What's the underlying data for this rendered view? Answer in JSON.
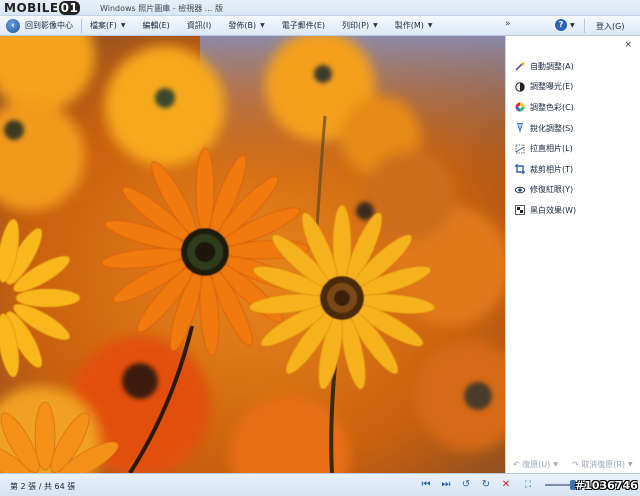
{
  "titlebar": {
    "logo": "MOBILE01",
    "title": "Windows 照片圖庫 - 檢視器 ... 版"
  },
  "menubar": {
    "back_label": "回到影像中心",
    "items": [
      {
        "label": "檔案(F)",
        "has_menu": true
      },
      {
        "label": "編輯(E)",
        "has_menu": false
      },
      {
        "label": "資訊(I)",
        "has_menu": false
      },
      {
        "label": "發佈(B)",
        "has_menu": true
      },
      {
        "label": "電子郵件(E)",
        "has_menu": false
      },
      {
        "label": "列印(P)",
        "has_menu": true
      },
      {
        "label": "製作(M)",
        "has_menu": true
      }
    ],
    "overflow": "»",
    "login": "登入(G)"
  },
  "panel": {
    "close": "×",
    "tools": [
      {
        "label": "自動調整(A)",
        "icon": "wand-icon"
      },
      {
        "label": "調整曝光(E)",
        "icon": "exposure-icon"
      },
      {
        "label": "調整色彩(C)",
        "icon": "color-wheel-icon"
      },
      {
        "label": "銳化調整(S)",
        "icon": "sharpen-icon"
      },
      {
        "label": "拉直相片(L)",
        "icon": "straighten-icon"
      },
      {
        "label": "裁剪相片(T)",
        "icon": "crop-icon"
      },
      {
        "label": "修復紅眼(Y)",
        "icon": "redeye-icon"
      },
      {
        "label": "黑白效果(W)",
        "icon": "bw-icon"
      }
    ],
    "undo": "復原(U)",
    "redo": "取消復原(R)"
  },
  "status": {
    "text": "第 2 張 / 共 64 張",
    "watermark_id": "#1036746"
  },
  "colors": {
    "accent": "#1e63b8",
    "delete": "#d0202a"
  }
}
